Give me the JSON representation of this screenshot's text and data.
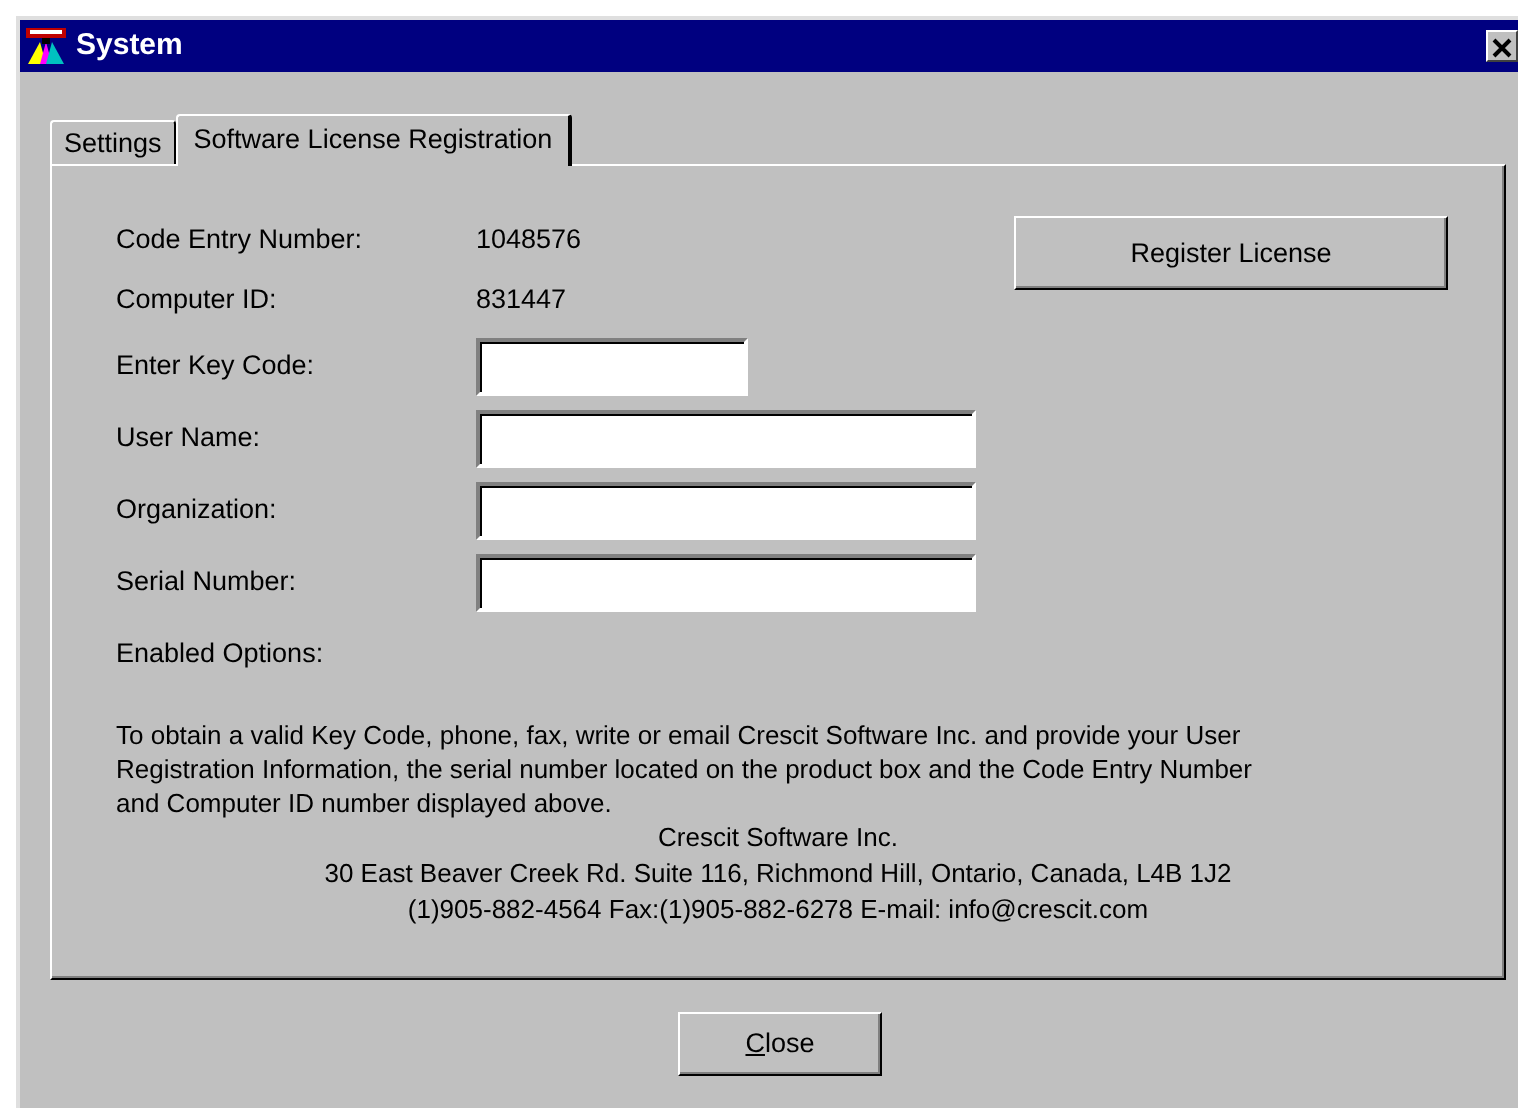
{
  "window": {
    "title": "System"
  },
  "tabs": [
    {
      "label": "Settings",
      "selected": false
    },
    {
      "label": "Software License Registration",
      "selected": true
    }
  ],
  "info_rows": [
    {
      "label": "Code Entry Number:",
      "value": "1048576"
    },
    {
      "label": "Computer ID:",
      "value": "831447"
    }
  ],
  "fields": [
    {
      "label": "Enter Key Code:",
      "kind": "short"
    },
    {
      "label": "User Name:",
      "kind": "long"
    },
    {
      "label": "Organization:",
      "kind": "long"
    },
    {
      "label": "Serial Number:",
      "kind": "long"
    }
  ],
  "enabled_options_label": "Enabled Options:",
  "register_button": "Register License",
  "instructions": "To obtain a valid Key Code, phone, fax, write or email Crescit Software Inc. and provide your User Registration Information, the serial number located on the product box and the Code Entry Number and Computer ID number displayed above.",
  "contact_lines": [
    "Crescit Software Inc.",
    "30 East Beaver Creek Rd. Suite 116, Richmond Hill, Ontario, Canada, L4B 1J2",
    "(1)905-882-4564  Fax:(1)905-882-6278  E-mail: info@crescit.com"
  ],
  "close_button": {
    "mnemonic": "C",
    "rest": "lose"
  }
}
